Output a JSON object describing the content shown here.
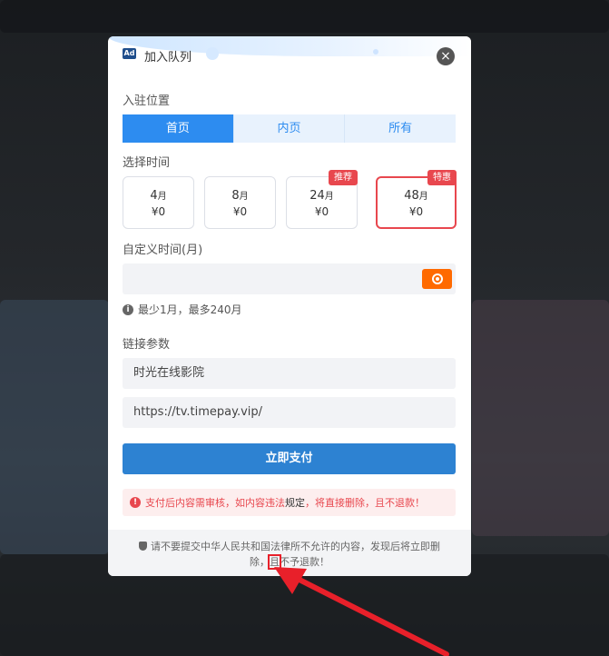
{
  "modal": {
    "ad_badge": "Ad",
    "title": "加入队列",
    "close": "×"
  },
  "position": {
    "label": "入驻位置",
    "tabs": [
      {
        "label": "首页",
        "active": true
      },
      {
        "label": "内页",
        "active": false
      },
      {
        "label": "所有",
        "active": false
      }
    ]
  },
  "time": {
    "label": "选择时间",
    "options": [
      {
        "num": "4",
        "unit": "月",
        "price": "¥0",
        "tag": ""
      },
      {
        "num": "8",
        "unit": "月",
        "price": "¥0",
        "tag": ""
      },
      {
        "num": "24",
        "unit": "月",
        "price": "¥0",
        "tag": "推荐"
      },
      {
        "num": "48",
        "unit": "月",
        "price": "¥0",
        "tag": "特惠",
        "selected": true
      }
    ]
  },
  "custom": {
    "label": "自定义时间(月)",
    "value": "",
    "hint": "最少1月，最多240月"
  },
  "link": {
    "label": "链接参数",
    "name_value": "时光在线影院",
    "url_value": "https://tv.timepay.vip/"
  },
  "pay_button": "立即支付",
  "warning": {
    "part1": "支付后内容需审核，如内容违法",
    "part2": "规定",
    "part3": "，将直接删除，且不退款！"
  },
  "footer": {
    "line1": "请不要提交中华人民共和国法律所不允许的内容，发现后将立即删",
    "line2a": "除，",
    "line2b": "且",
    "line2c": "不予退款！"
  },
  "colors": {
    "primary": "#2d8cf0",
    "pay": "#2d82d2",
    "danger": "#e8474e",
    "orange": "#ff6a00"
  }
}
